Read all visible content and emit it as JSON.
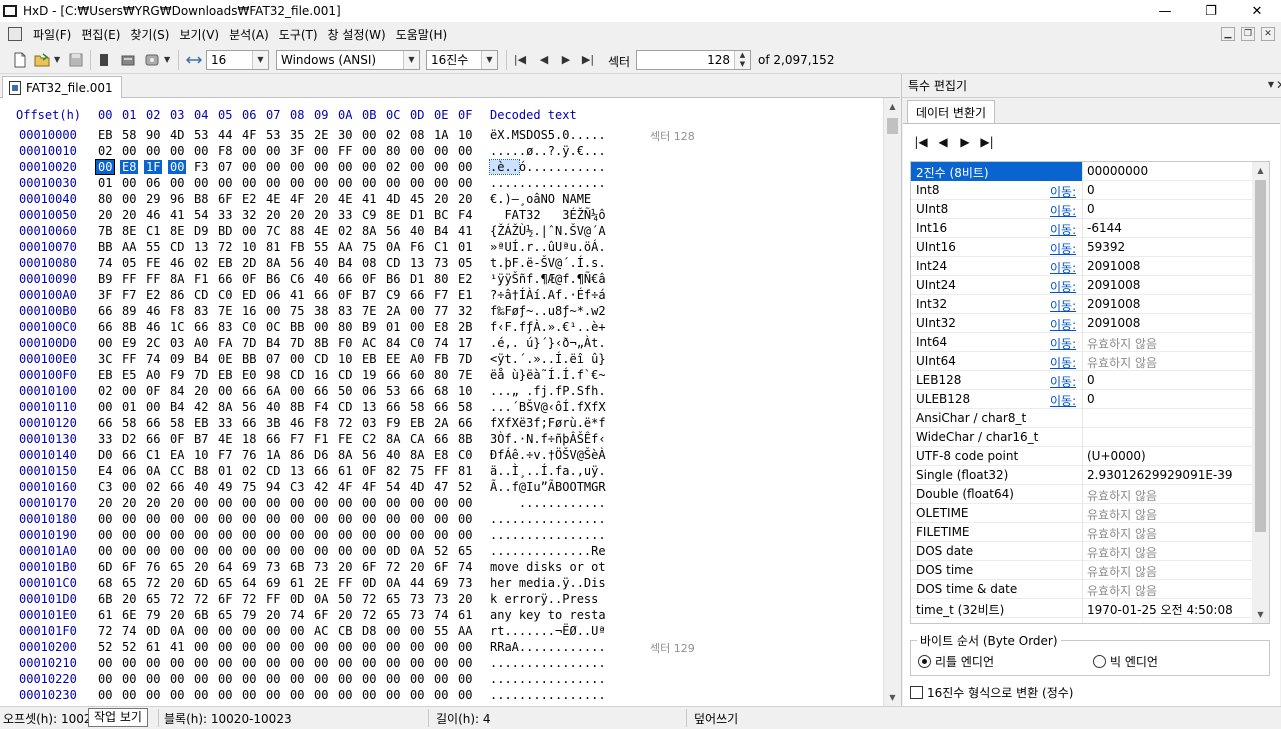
{
  "window": {
    "title": "HxD - [C:₩Users₩YRG₩Downloads₩FAT32_file.001]",
    "minimize": "—",
    "maximize": "❐",
    "close": "✕"
  },
  "menu": [
    "파일(F)",
    "편집(E)",
    "찾기(S)",
    "보기(V)",
    "분석(A)",
    "도구(T)",
    "창 설정(W)",
    "도움말(H)"
  ],
  "toolbar": {
    "bytes_per_row": "16",
    "charset": "Windows (ANSI)",
    "offset_base": "16진수",
    "sector_label": "섹터",
    "sector_value": "128",
    "sector_total": "of 2,097,152"
  },
  "tabs": {
    "file": "FAT32_file.001"
  },
  "hex": {
    "offset_header": "Offset(h)",
    "columns": [
      "00",
      "01",
      "02",
      "03",
      "04",
      "05",
      "06",
      "07",
      "08",
      "09",
      "0A",
      "0B",
      "0C",
      "0D",
      "0E",
      "0F"
    ],
    "decoded_header": "Decoded text",
    "rows": [
      {
        "offset": "00010000",
        "bytes": [
          "EB",
          "58",
          "90",
          "4D",
          "53",
          "44",
          "4F",
          "53",
          "35",
          "2E",
          "30",
          "00",
          "02",
          "08",
          "1A",
          "10"
        ],
        "text": "ëX.MSDOS5.0.....",
        "sector": "섹터 128"
      },
      {
        "offset": "00010010",
        "bytes": [
          "02",
          "00",
          "00",
          "00",
          "00",
          "F8",
          "00",
          "00",
          "3F",
          "00",
          "FF",
          "00",
          "80",
          "00",
          "00",
          "00"
        ],
        "text": ".....ø..?.ÿ.€...",
        "sector": ""
      },
      {
        "offset": "00010020",
        "bytes": [
          "00",
          "E8",
          "1F",
          "00",
          "F3",
          "07",
          "00",
          "00",
          "00",
          "00",
          "00",
          "00",
          "02",
          "00",
          "00",
          "00"
        ],
        "text": ".è..ó...........",
        "sector": ""
      },
      {
        "offset": "00010030",
        "bytes": [
          "01",
          "00",
          "06",
          "00",
          "00",
          "00",
          "00",
          "00",
          "00",
          "00",
          "00",
          "00",
          "00",
          "00",
          "00",
          "00"
        ],
        "text": "................",
        "sector": ""
      },
      {
        "offset": "00010040",
        "bytes": [
          "80",
          "00",
          "29",
          "96",
          "B8",
          "6F",
          "E2",
          "4E",
          "4F",
          "20",
          "4E",
          "41",
          "4D",
          "45",
          "20",
          "20"
        ],
        "text": "€.)–¸oâNO NAME  ",
        "sector": ""
      },
      {
        "offset": "00010050",
        "bytes": [
          "20",
          "20",
          "46",
          "41",
          "54",
          "33",
          "32",
          "20",
          "20",
          "20",
          "33",
          "C9",
          "8E",
          "D1",
          "BC",
          "F4"
        ],
        "text": "  FAT32   3ÉŽÑ¼ô",
        "sector": ""
      },
      {
        "offset": "00010060",
        "bytes": [
          "7B",
          "8E",
          "C1",
          "8E",
          "D9",
          "BD",
          "00",
          "7C",
          "88",
          "4E",
          "02",
          "8A",
          "56",
          "40",
          "B4",
          "41"
        ],
        "text": "{ŽÁŽÙ½.|ˆN.ŠV@´A",
        "sector": ""
      },
      {
        "offset": "00010070",
        "bytes": [
          "BB",
          "AA",
          "55",
          "CD",
          "13",
          "72",
          "10",
          "81",
          "FB",
          "55",
          "AA",
          "75",
          "0A",
          "F6",
          "C1",
          "01"
        ],
        "text": "»ªUÍ.r..ûUªu.öÁ.",
        "sector": ""
      },
      {
        "offset": "00010080",
        "bytes": [
          "74",
          "05",
          "FE",
          "46",
          "02",
          "EB",
          "2D",
          "8A",
          "56",
          "40",
          "B4",
          "08",
          "CD",
          "13",
          "73",
          "05"
        ],
        "text": "t.þF.ë-ŠV@´.Í.s.",
        "sector": ""
      },
      {
        "offset": "00010090",
        "bytes": [
          "B9",
          "FF",
          "FF",
          "8A",
          "F1",
          "66",
          "0F",
          "B6",
          "C6",
          "40",
          "66",
          "0F",
          "B6",
          "D1",
          "80",
          "E2"
        ],
        "text": "¹ÿÿŠñf.¶Æ@f.¶Ñ€â",
        "sector": ""
      },
      {
        "offset": "000100A0",
        "bytes": [
          "3F",
          "F7",
          "E2",
          "86",
          "CD",
          "C0",
          "ED",
          "06",
          "41",
          "66",
          "0F",
          "B7",
          "C9",
          "66",
          "F7",
          "E1"
        ],
        "text": "?÷â†ÍÀí.Af.·Éf÷á",
        "sector": ""
      },
      {
        "offset": "000100B0",
        "bytes": [
          "66",
          "89",
          "46",
          "F8",
          "83",
          "7E",
          "16",
          "00",
          "75",
          "38",
          "83",
          "7E",
          "2A",
          "00",
          "77",
          "32"
        ],
        "text": "f‰Føƒ~..u8ƒ~*.w2",
        "sector": ""
      },
      {
        "offset": "000100C0",
        "bytes": [
          "66",
          "8B",
          "46",
          "1C",
          "66",
          "83",
          "C0",
          "0C",
          "BB",
          "00",
          "80",
          "B9",
          "01",
          "00",
          "E8",
          "2B"
        ],
        "text": "f‹F.fƒÀ.».€¹..è+",
        "sector": ""
      },
      {
        "offset": "000100D0",
        "bytes": [
          "00",
          "E9",
          "2C",
          "03",
          "A0",
          "FA",
          "7D",
          "B4",
          "7D",
          "8B",
          "F0",
          "AC",
          "84",
          "C0",
          "74",
          "17"
        ],
        "text": ".é,. ú}´}‹ð¬„Àt.",
        "sector": ""
      },
      {
        "offset": "000100E0",
        "bytes": [
          "3C",
          "FF",
          "74",
          "09",
          "B4",
          "0E",
          "BB",
          "07",
          "00",
          "CD",
          "10",
          "EB",
          "EE",
          "A0",
          "FB",
          "7D"
        ],
        "text": "<ÿt.´.»..Í.ëî û}",
        "sector": ""
      },
      {
        "offset": "000100F0",
        "bytes": [
          "EB",
          "E5",
          "A0",
          "F9",
          "7D",
          "EB",
          "E0",
          "98",
          "CD",
          "16",
          "CD",
          "19",
          "66",
          "60",
          "80",
          "7E"
        ],
        "text": "ëå ù}ëà˜Í.Í.f`€~",
        "sector": ""
      },
      {
        "offset": "00010100",
        "bytes": [
          "02",
          "00",
          "0F",
          "84",
          "20",
          "00",
          "66",
          "6A",
          "00",
          "66",
          "50",
          "06",
          "53",
          "66",
          "68",
          "10"
        ],
        "text": "...„ .fj.fP.Sfh.",
        "sector": ""
      },
      {
        "offset": "00010110",
        "bytes": [
          "00",
          "01",
          "00",
          "B4",
          "42",
          "8A",
          "56",
          "40",
          "8B",
          "F4",
          "CD",
          "13",
          "66",
          "58",
          "66",
          "58"
        ],
        "text": "...´BŠV@‹ôÍ.fXfX",
        "sector": ""
      },
      {
        "offset": "00010120",
        "bytes": [
          "66",
          "58",
          "66",
          "58",
          "EB",
          "33",
          "66",
          "3B",
          "46",
          "F8",
          "72",
          "03",
          "F9",
          "EB",
          "2A",
          "66"
        ],
        "text": "fXfXë3f;Førù.ë*f",
        "sector": ""
      },
      {
        "offset": "00010130",
        "bytes": [
          "33",
          "D2",
          "66",
          "0F",
          "B7",
          "4E",
          "18",
          "66",
          "F7",
          "F1",
          "FE",
          "C2",
          "8A",
          "CA",
          "66",
          "8B"
        ],
        "text": "3Òf.·N.f÷ñþÂŠÊf‹",
        "sector": ""
      },
      {
        "offset": "00010140",
        "bytes": [
          "D0",
          "66",
          "C1",
          "EA",
          "10",
          "F7",
          "76",
          "1A",
          "86",
          "D6",
          "8A",
          "56",
          "40",
          "8A",
          "E8",
          "C0"
        ],
        "text": "ÐfÁê.÷v.†ÖŠV@ŠèÀ",
        "sector": ""
      },
      {
        "offset": "00010150",
        "bytes": [
          "E4",
          "06",
          "0A",
          "CC",
          "B8",
          "01",
          "02",
          "CD",
          "13",
          "66",
          "61",
          "0F",
          "82",
          "75",
          "FF",
          "81"
        ],
        "text": "ä..Ì¸..Í.fa.‚uÿ.",
        "sector": ""
      },
      {
        "offset": "00010160",
        "bytes": [
          "C3",
          "00",
          "02",
          "66",
          "40",
          "49",
          "75",
          "94",
          "C3",
          "42",
          "4F",
          "4F",
          "54",
          "4D",
          "47",
          "52"
        ],
        "text": "Ã..f@Iu”ÃBOOTMGR",
        "sector": ""
      },
      {
        "offset": "00010170",
        "bytes": [
          "20",
          "20",
          "20",
          "20",
          "00",
          "00",
          "00",
          "00",
          "00",
          "00",
          "00",
          "00",
          "00",
          "00",
          "00",
          "00"
        ],
        "text": "    ............",
        "sector": ""
      },
      {
        "offset": "00010180",
        "bytes": [
          "00",
          "00",
          "00",
          "00",
          "00",
          "00",
          "00",
          "00",
          "00",
          "00",
          "00",
          "00",
          "00",
          "00",
          "00",
          "00"
        ],
        "text": "................",
        "sector": ""
      },
      {
        "offset": "00010190",
        "bytes": [
          "00",
          "00",
          "00",
          "00",
          "00",
          "00",
          "00",
          "00",
          "00",
          "00",
          "00",
          "00",
          "00",
          "00",
          "00",
          "00"
        ],
        "text": "................",
        "sector": ""
      },
      {
        "offset": "000101A0",
        "bytes": [
          "00",
          "00",
          "00",
          "00",
          "00",
          "00",
          "00",
          "00",
          "00",
          "00",
          "00",
          "00",
          "0D",
          "0A",
          "52",
          "65"
        ],
        "text": "..............Re",
        "sector": ""
      },
      {
        "offset": "000101B0",
        "bytes": [
          "6D",
          "6F",
          "76",
          "65",
          "20",
          "64",
          "69",
          "73",
          "6B",
          "73",
          "20",
          "6F",
          "72",
          "20",
          "6F",
          "74"
        ],
        "text": "move disks or ot",
        "sector": ""
      },
      {
        "offset": "000101C0",
        "bytes": [
          "68",
          "65",
          "72",
          "20",
          "6D",
          "65",
          "64",
          "69",
          "61",
          "2E",
          "FF",
          "0D",
          "0A",
          "44",
          "69",
          "73"
        ],
        "text": "her media.ÿ..Dis",
        "sector": ""
      },
      {
        "offset": "000101D0",
        "bytes": [
          "6B",
          "20",
          "65",
          "72",
          "72",
          "6F",
          "72",
          "FF",
          "0D",
          "0A",
          "50",
          "72",
          "65",
          "73",
          "73",
          "20"
        ],
        "text": "k errorÿ..Press ",
        "sector": ""
      },
      {
        "offset": "000101E0",
        "bytes": [
          "61",
          "6E",
          "79",
          "20",
          "6B",
          "65",
          "79",
          "20",
          "74",
          "6F",
          "20",
          "72",
          "65",
          "73",
          "74",
          "61"
        ],
        "text": "any key to resta",
        "sector": ""
      },
      {
        "offset": "000101F0",
        "bytes": [
          "72",
          "74",
          "0D",
          "0A",
          "00",
          "00",
          "00",
          "00",
          "00",
          "AC",
          "CB",
          "D8",
          "00",
          "00",
          "55",
          "AA"
        ],
        "text": "rt.......¬ËØ..Uª",
        "sector": ""
      },
      {
        "offset": "00010200",
        "bytes": [
          "52",
          "52",
          "61",
          "41",
          "00",
          "00",
          "00",
          "00",
          "00",
          "00",
          "00",
          "00",
          "00",
          "00",
          "00",
          "00"
        ],
        "text": "RRaA............",
        "sector": "섹터 129"
      },
      {
        "offset": "00010210",
        "bytes": [
          "00",
          "00",
          "00",
          "00",
          "00",
          "00",
          "00",
          "00",
          "00",
          "00",
          "00",
          "00",
          "00",
          "00",
          "00",
          "00"
        ],
        "text": "................",
        "sector": ""
      },
      {
        "offset": "00010220",
        "bytes": [
          "00",
          "00",
          "00",
          "00",
          "00",
          "00",
          "00",
          "00",
          "00",
          "00",
          "00",
          "00",
          "00",
          "00",
          "00",
          "00"
        ],
        "text": "................",
        "sector": ""
      },
      {
        "offset": "00010230",
        "bytes": [
          "00",
          "00",
          "00",
          "00",
          "00",
          "00",
          "00",
          "00",
          "00",
          "00",
          "00",
          "00",
          "00",
          "00",
          "00",
          "00"
        ],
        "text": "................",
        "sector": ""
      }
    ]
  },
  "panel": {
    "title": "특수 편집기",
    "tab": "데이터 변환기",
    "edit_link": "이동:",
    "rows": [
      {
        "name": "2진수 (8비트)",
        "edit": false,
        "value": "00000000",
        "gray": false,
        "selected": true
      },
      {
        "name": "Int8",
        "edit": true,
        "value": "0",
        "gray": false
      },
      {
        "name": "UInt8",
        "edit": true,
        "value": "0",
        "gray": false
      },
      {
        "name": "Int16",
        "edit": true,
        "value": "-6144",
        "gray": false
      },
      {
        "name": "UInt16",
        "edit": true,
        "value": "59392",
        "gray": false
      },
      {
        "name": "Int24",
        "edit": true,
        "value": "2091008",
        "gray": false
      },
      {
        "name": "UInt24",
        "edit": true,
        "value": "2091008",
        "gray": false
      },
      {
        "name": "Int32",
        "edit": true,
        "value": "2091008",
        "gray": false
      },
      {
        "name": "UInt32",
        "edit": true,
        "value": "2091008",
        "gray": false
      },
      {
        "name": "Int64",
        "edit": true,
        "value": "유효하지 않음",
        "gray": true
      },
      {
        "name": "UInt64",
        "edit": true,
        "value": "유효하지 않음",
        "gray": true
      },
      {
        "name": "LEB128",
        "edit": true,
        "value": "0",
        "gray": false
      },
      {
        "name": "ULEB128",
        "edit": true,
        "value": "0",
        "gray": false
      },
      {
        "name": "AnsiChar / char8_t",
        "edit": false,
        "value": "",
        "gray": false
      },
      {
        "name": "WideChar / char16_t",
        "edit": false,
        "value": "",
        "gray": false
      },
      {
        "name": "UTF-8 code point",
        "edit": false,
        "value": "   (U+0000)",
        "gray": false
      },
      {
        "name": "Single (float32)",
        "edit": false,
        "value": "2.93012629929091E-39",
        "gray": false
      },
      {
        "name": "Double (float64)",
        "edit": false,
        "value": "유효하지 않음",
        "gray": true
      },
      {
        "name": "OLETIME",
        "edit": false,
        "value": "유효하지 않음",
        "gray": true
      },
      {
        "name": "FILETIME",
        "edit": false,
        "value": "유효하지 않음",
        "gray": true
      },
      {
        "name": "DOS date",
        "edit": false,
        "value": "유효하지 않음",
        "gray": true
      },
      {
        "name": "DOS time",
        "edit": false,
        "value": "유효하지 않음",
        "gray": true
      },
      {
        "name": "DOS time & date",
        "edit": false,
        "value": "유효하지 않음",
        "gray": true
      },
      {
        "name": "time_t (32비트)",
        "edit": false,
        "value": "1970-01-25 오전 4:50:08",
        "gray": false
      },
      {
        "name": "time_t (64비트)",
        "edit": false,
        "value": "유효하지 않음",
        "gray": true
      }
    ],
    "byte_order_label": "바이트 순서 (Byte Order)",
    "little_endian": "리틀 엔디언",
    "big_endian": "빅 엔디언",
    "hex_checkbox": "16진수 형식으로 변환 (정수)"
  },
  "status": {
    "offset": "오프셋(h): 1002",
    "tooltip": "작업 보기",
    "block": "블록(h): 10020-10023",
    "length": "길이(h): 4",
    "mode": "덮어쓰기"
  }
}
